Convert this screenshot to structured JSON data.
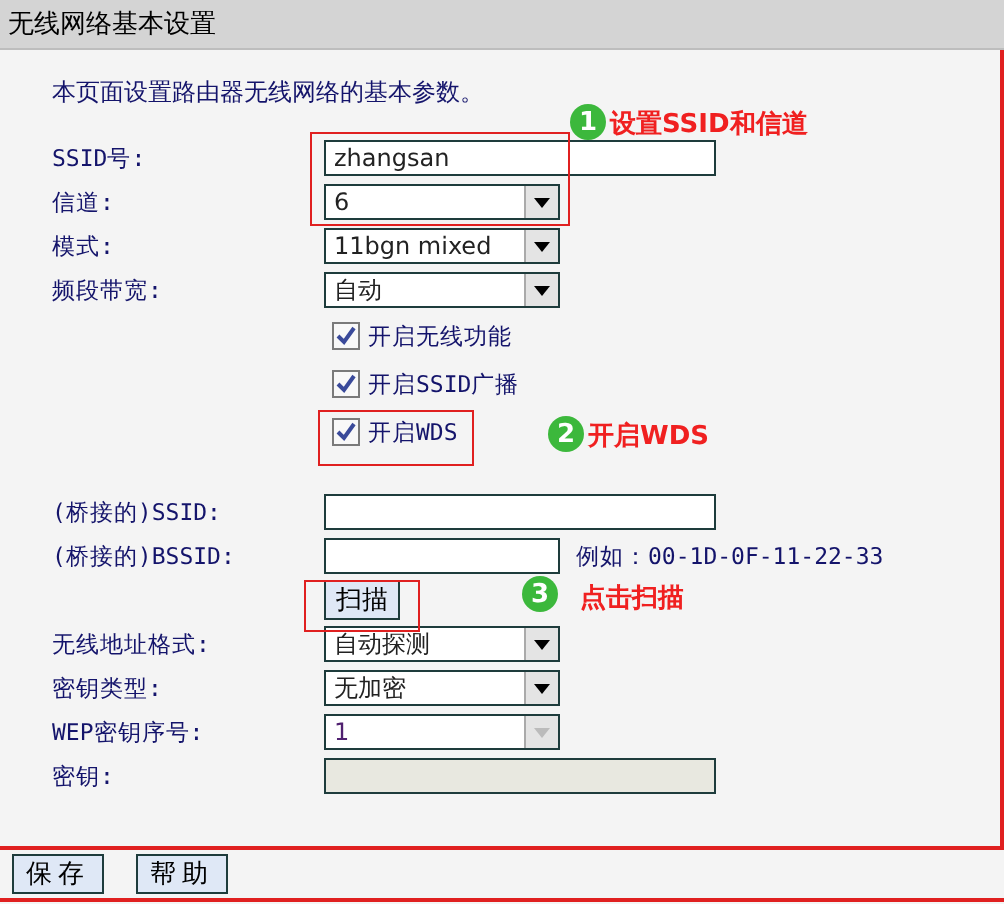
{
  "header": {
    "title": "无线网络基本设置"
  },
  "intro": "本页面设置路由器无线网络的基本参数。",
  "fields": [
    {
      "kind": "text",
      "label": "SSID号:",
      "value": "zhangsan"
    },
    {
      "kind": "select",
      "label": "信道:",
      "value": "6",
      "disabled": false
    },
    {
      "kind": "select",
      "label": "模式:",
      "value": "11bgn mixed",
      "disabled": false
    },
    {
      "kind": "select",
      "label": "频段带宽:",
      "value": "自动",
      "disabled": false
    },
    {
      "kind": "checkbox",
      "label": "开启无线功能",
      "checked": true
    },
    {
      "kind": "checkbox",
      "label": "开启SSID广播",
      "checked": true
    },
    {
      "kind": "checkbox",
      "label": "开启WDS",
      "checked": true
    },
    {
      "kind": "spacer"
    },
    {
      "kind": "text",
      "label": "(桥接的)SSID:"
    },
    {
      "kind": "short_text",
      "label": "(桥接的)BSSID:",
      "hint": "例如：00-1D-0F-11-22-33"
    },
    {
      "kind": "button",
      "label": "扫描"
    },
    {
      "kind": "select",
      "label": "无线地址格式:",
      "value": "自动探测",
      "disabled": false
    },
    {
      "kind": "select",
      "label": "密钥类型:",
      "value": "无加密",
      "disabled": false
    },
    {
      "kind": "select",
      "label": "WEP密钥序号:",
      "value": "1",
      "disabled": true
    },
    {
      "kind": "text",
      "label": "密钥:",
      "disabled": true
    }
  ],
  "annotations": [
    {
      "number": "1",
      "text": "设置SSID和信道"
    },
    {
      "number": "2",
      "text": "开启WDS"
    },
    {
      "number": "3",
      "text": "点击扫描"
    }
  ],
  "footer": {
    "buttons": [
      "保存",
      "帮助"
    ]
  }
}
